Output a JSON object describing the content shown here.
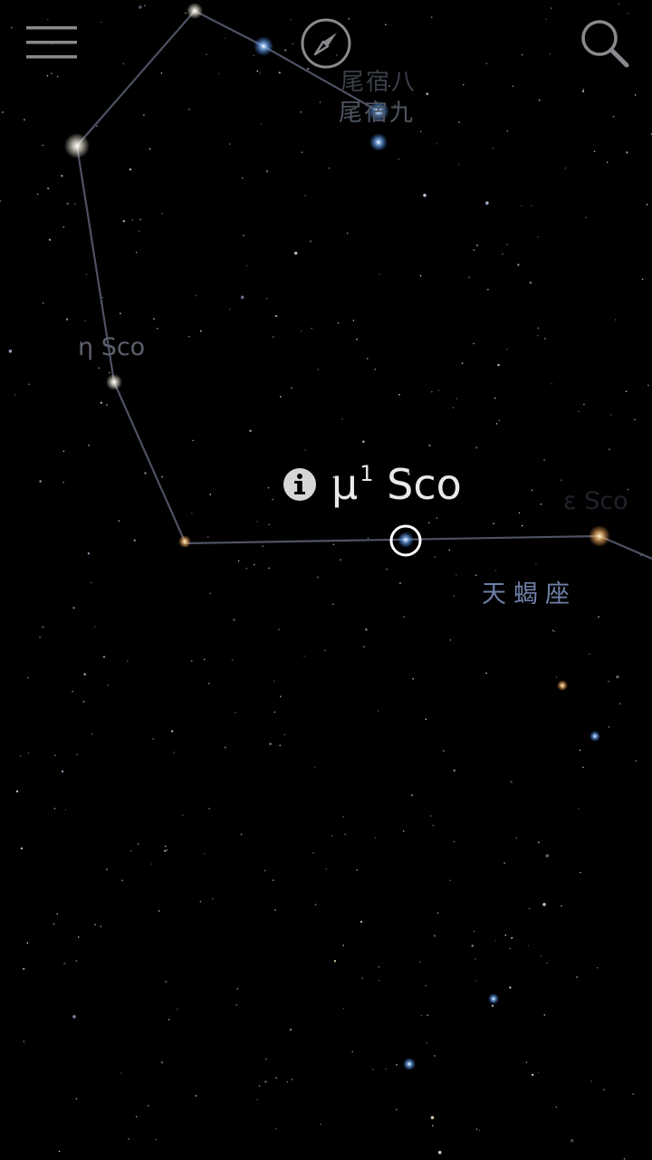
{
  "toolbar": {
    "menu_icon": "hamburger-menu-icon",
    "compass_icon": "compass-icon",
    "search_icon": "search-icon"
  },
  "selection": {
    "name": "μ",
    "superscript": "1",
    "suffix": " Sco",
    "info_icon": "info-icon"
  },
  "labels": {
    "weisu8": "尾宿八",
    "weisu9": "尾宿九",
    "eta_sco": "η Sco",
    "epsilon_sco": "ε Sco",
    "constellation": "天蝎座"
  },
  "colors": {
    "background": "#000000",
    "constellation_line": "#4d5263",
    "selection_ring": "#ffffff",
    "constellation_label": "#6f80a8"
  }
}
